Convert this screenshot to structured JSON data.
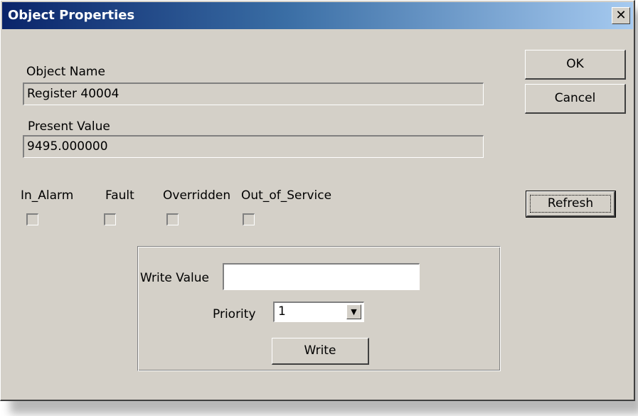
{
  "window": {
    "title": "Object Properties",
    "close_glyph": "✕"
  },
  "object_name": {
    "label": "Object Name",
    "value": "Register 40004"
  },
  "present_value": {
    "label": "Present Value",
    "value": "9495.000000"
  },
  "status_flags": [
    {
      "label": "In_Alarm",
      "checked": false
    },
    {
      "label": "Fault",
      "checked": false
    },
    {
      "label": "Overridden",
      "checked": false
    },
    {
      "label": "Out_of_Service",
      "checked": false
    }
  ],
  "buttons": {
    "ok": "OK",
    "cancel": "Cancel",
    "refresh": "Refresh"
  },
  "write_group": {
    "write_value_label": "Write Value",
    "write_value": "",
    "priority_label": "Priority",
    "priority_selected": "1",
    "write_button": "Write"
  },
  "icons": {
    "close": "close-icon",
    "dropdown": "chevron-down-icon"
  }
}
